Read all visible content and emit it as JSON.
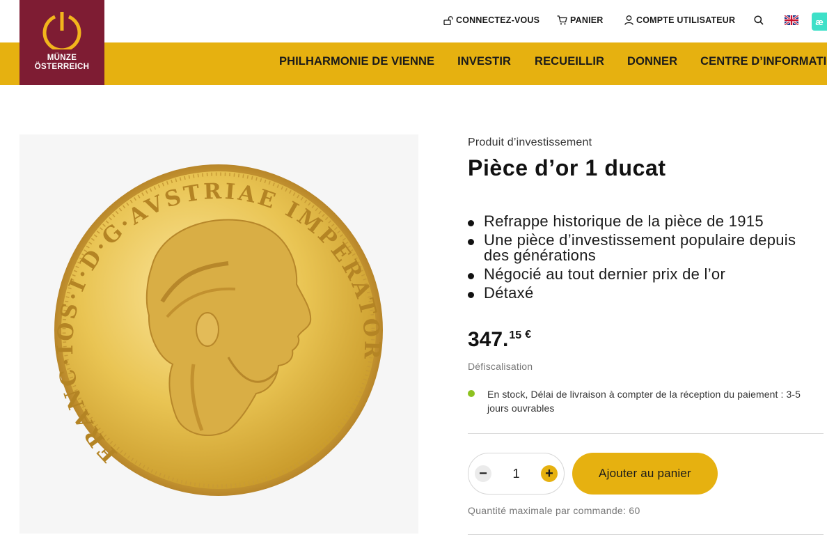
{
  "brand": {
    "line1": "MÜNZE",
    "line2": "ÖSTERREICH",
    "color": "#7e1c33"
  },
  "topbar": {
    "login": "CONNECTEZ-VOUS",
    "cart": "PANIER",
    "account": "COMPTE UTILISATEUR",
    "search_icon": "search-icon",
    "language_flag": "flag-uk-icon",
    "chat_badge": "æ"
  },
  "nav": {
    "items": [
      "PHILHARMONIE DE VIENNE",
      "INVESTIR",
      "RECUEILLIR",
      "DONNER",
      "CENTRE D’INFORMATION"
    ],
    "bar_color": "#e6b110"
  },
  "coin": {
    "inscription": "FRANC·IOS·I·D·G·AVSTRIAE IMPERATOR"
  },
  "product": {
    "category": "Produit d’investissement",
    "title": "Pièce d’or 1 ducat",
    "features": [
      "Refrappe historique de la pièce de 1915",
      "Une pièce d’investissement populaire depuis des générations",
      "Négocié au tout dernier prix de l’or",
      "Détaxé"
    ],
    "price": {
      "main": "347.",
      "cents": "15",
      "currency": "€"
    },
    "tax_note": "Défiscalisation",
    "stock": {
      "status_color": "#8dc21f",
      "text": "En stock, Délai de livraison à compter de la réception du paiement : 3-5 jours ouvrables"
    },
    "quantity": {
      "value": "1",
      "minus": "−",
      "plus": "+"
    },
    "add_to_cart": "Ajouter au panier",
    "max_quantity": "Quantité maximale par commande: 60"
  }
}
